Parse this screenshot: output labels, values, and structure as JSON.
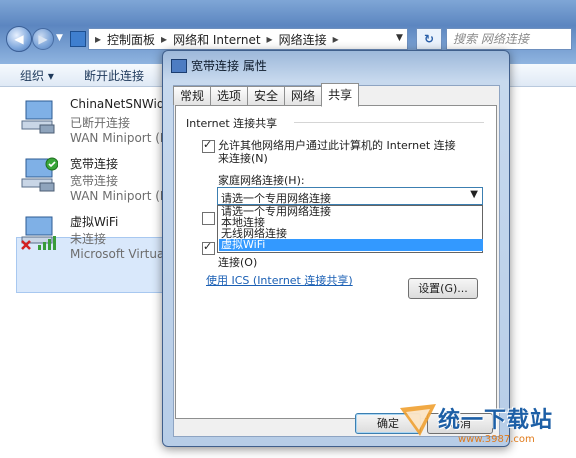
{
  "explorer": {
    "address": [
      "控制面板",
      "网络和 Internet",
      "网络连接"
    ],
    "search_placeholder": "搜索 网络连接",
    "toolbar": {
      "organize": "组织 ▾",
      "disconnect": "断开此连接"
    },
    "connections": [
      {
        "name": "ChinaNetSNWide",
        "status": "已断开连接",
        "device": "WAN Miniport (P"
      },
      {
        "name": "宽带连接",
        "status": "宽带连接",
        "device": "WAN Miniport (P"
      },
      {
        "name": "虚拟WiFi",
        "status": "未连接",
        "device": "Microsoft Virtual"
      }
    ]
  },
  "dialog": {
    "title": "宽带连接 属性",
    "tabs": [
      "常规",
      "选项",
      "安全",
      "网络",
      "共享"
    ],
    "active_tab": "共享",
    "group_title": "Internet 连接共享",
    "allow_sharing": {
      "checked": true,
      "line1": "允许其他网络用户通过此计算机的 Internet 连接",
      "line2": "来连接(N)"
    },
    "home_network_label": "家庭网络连接(H):",
    "combo_value": "请选一个专用网络连接",
    "dropdown_options": [
      "请选一个专用网络连接",
      "本地连接",
      "无线网络连接",
      "虚拟WiFi"
    ],
    "highlighted_option": "虚拟WiFi",
    "second_checkbox_checked": false,
    "third_checkbox": {
      "checked": true,
      "line2": "连接(O)"
    },
    "ics_link": "使用 ICS (Internet 连接共享)",
    "settings_button": "设置(G)...",
    "ok_button": "确定",
    "cancel_button": "取消"
  },
  "watermark": {
    "title": "统一下载站",
    "url": "www.3987.com"
  }
}
